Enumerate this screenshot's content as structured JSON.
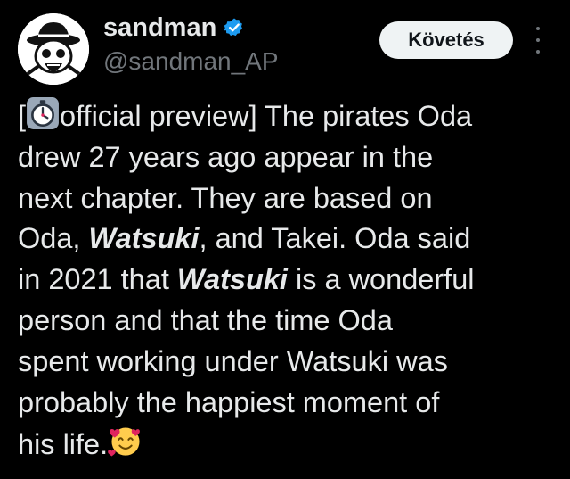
{
  "author": {
    "display_name": "sandman",
    "handle": "@sandman_AP",
    "verified": true,
    "avatar_icon": "straw-hat-skull-avatar",
    "verified_icon": "verified-badge-icon"
  },
  "actions": {
    "follow_label": "Követés",
    "more_icon": "more-vertical-icon"
  },
  "colors": {
    "background": "#000000",
    "text": "#e7e9ea",
    "secondary_text": "#71767b",
    "verified_blue": "#1d9bf0",
    "button_bg": "#eff3f4"
  },
  "post": {
    "lines": [
      {
        "segments": [
          {
            "t": "["
          },
          {
            "emoji": "alarm-clock-emoji"
          },
          {
            "t": "official preview] The pirates Oda"
          }
        ]
      },
      {
        "segments": [
          {
            "t": "drew 27 years ago appear in the"
          }
        ]
      },
      {
        "segments": [
          {
            "t": "next chapter. They are based on"
          }
        ]
      },
      {
        "segments": [
          {
            "t": "Oda, "
          },
          {
            "t": "Watsuki",
            "em": true
          },
          {
            "t": ", and Takei. Oda said"
          }
        ]
      },
      {
        "segments": [
          {
            "t": "in 2021 that "
          },
          {
            "t": "Watsuki",
            "em": true
          },
          {
            "t": " is a wonderful"
          }
        ]
      },
      {
        "segments": [
          {
            "t": "person and that the time Oda"
          }
        ]
      },
      {
        "segments": [
          {
            "t": "spent working under Watsuki was"
          }
        ]
      },
      {
        "segments": [
          {
            "t": "probably the happiest moment of"
          }
        ]
      },
      {
        "segments": [
          {
            "t": "his life."
          },
          {
            "emoji": "smiling-face-with-hearts-emoji"
          }
        ]
      }
    ]
  }
}
